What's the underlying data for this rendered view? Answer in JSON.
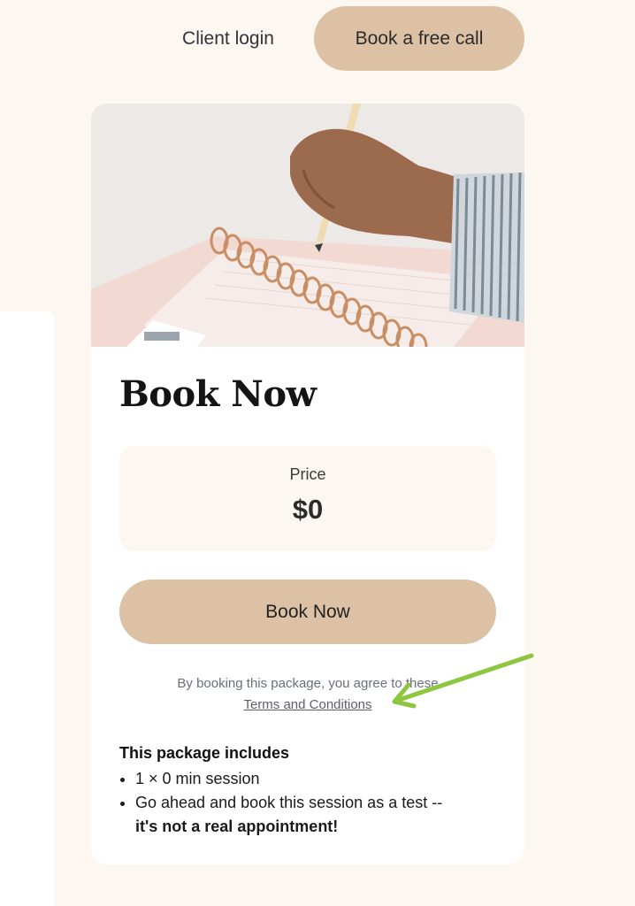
{
  "nav": {
    "client_login": "Client login",
    "free_call": "Book a free call"
  },
  "card": {
    "image_alt_icon": "notebook-writing-photo",
    "title": "Book Now",
    "price": {
      "label": "Price",
      "value": "$0"
    },
    "book_button": "Book Now",
    "agreement": {
      "text": "By booking this package, you agree to these",
      "link": "Terms and Conditions"
    },
    "includes": {
      "title": "This package includes",
      "items": [
        {
          "text": "1 × 0 min session",
          "bold": ""
        },
        {
          "text": "Go ahead and book this session as a test --",
          "bold": "it's not a real appointment!"
        }
      ]
    }
  },
  "colors": {
    "background": "#fcf8f1",
    "accent": "#dcc1a5",
    "card": "#ffffff",
    "annotation_arrow": "#8dc63f"
  }
}
